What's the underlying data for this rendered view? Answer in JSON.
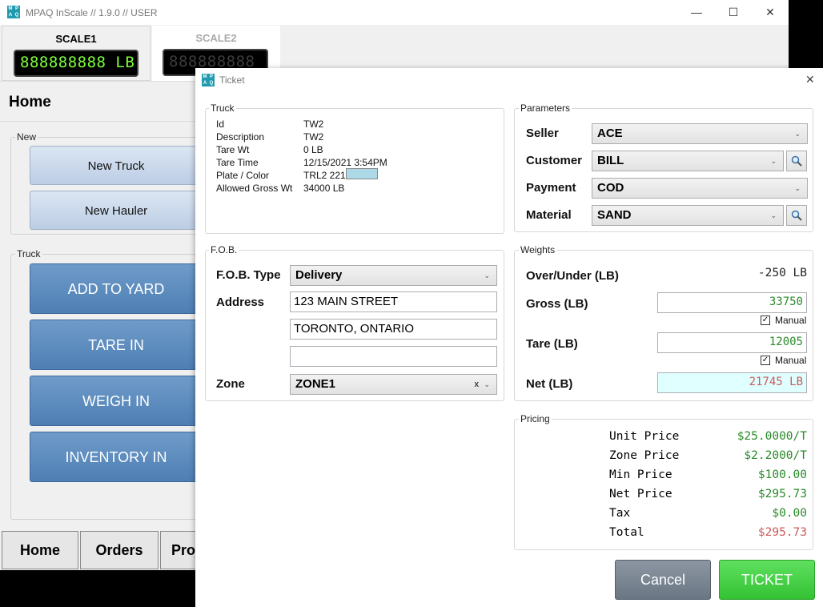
{
  "app": {
    "title": "MPAQ InScale // 1.9.0 // USER",
    "logo_letters": [
      "M",
      "P",
      "A",
      "Q"
    ],
    "controls": {
      "minimize": "—",
      "maximize": "☐",
      "close": "✕"
    },
    "scales": [
      {
        "name": "SCALE1",
        "display": "888888888 LB"
      },
      {
        "name": "SCALE2",
        "display": "888888888"
      }
    ],
    "page_title": "Home",
    "new_group": {
      "label": "New",
      "buttons": [
        "New Truck",
        "New Hauler"
      ]
    },
    "truck_group": {
      "label": "Truck",
      "buttons": [
        "ADD TO YARD",
        "TARE IN",
        "WEIGH IN",
        "INVENTORY IN"
      ]
    },
    "nav": [
      "Home",
      "Orders",
      "Proj"
    ]
  },
  "dialog": {
    "title": "Ticket",
    "close": "✕",
    "truck": {
      "legend": "Truck",
      "rows": [
        {
          "label": "Id",
          "value": "TW2"
        },
        {
          "label": "Description",
          "value": "TW2"
        },
        {
          "label": "Tare Wt",
          "value": "0 LB"
        },
        {
          "label": "Tare Time",
          "value": "12/15/2021 3:54PM"
        },
        {
          "label": "Plate / Color",
          "value": "TRL2 221"
        },
        {
          "label": "Allowed Gross Wt",
          "value": "34000 LB"
        }
      ],
      "plate_color": "#add8e6"
    },
    "parameters": {
      "legend": "Parameters",
      "seller": {
        "label": "Seller",
        "value": "ACE"
      },
      "customer": {
        "label": "Customer",
        "value": "BILL"
      },
      "payment": {
        "label": "Payment",
        "value": "COD"
      },
      "material": {
        "label": "Material",
        "value": "SAND"
      }
    },
    "fob": {
      "legend": "F.O.B.",
      "type_label": "F.O.B. Type",
      "type_value": "Delivery",
      "address_label": "Address",
      "address_lines": [
        "123 MAIN STREET",
        "TORONTO, ONTARIO",
        ""
      ],
      "zone_label": "Zone",
      "zone_value": "ZONE1",
      "zone_clear": "x"
    },
    "weights": {
      "legend": "Weights",
      "over_under_label": "Over/Under (LB)",
      "over_under_value": "-250 LB",
      "gross_label": "Gross (LB)",
      "gross_value": "33750",
      "gross_manual": "Manual",
      "tare_label": "Tare (LB)",
      "tare_value": "12005",
      "tare_manual": "Manual",
      "net_label": "Net (LB)",
      "net_value": "21745 LB"
    },
    "pricing": {
      "legend": "Pricing",
      "rows": [
        {
          "label": "Unit Price",
          "value": "$25.0000/T"
        },
        {
          "label": "Zone Price",
          "value": "$2.2000/T"
        },
        {
          "label": "Min Price",
          "value": "$100.00"
        },
        {
          "label": "Net Price",
          "value": "$295.73"
        },
        {
          "label": "Tax",
          "value": "$0.00"
        },
        {
          "label": "Total",
          "value": "$295.73"
        }
      ]
    },
    "buttons": {
      "cancel": "Cancel",
      "ticket": "TICKET"
    },
    "colors": {
      "ticket_button": "#45d145",
      "cancel_button": "#7a8593",
      "net_field_bg": "#e0ffff",
      "value_green": "#2a8a2a",
      "value_red": "#cc5a5a"
    }
  }
}
